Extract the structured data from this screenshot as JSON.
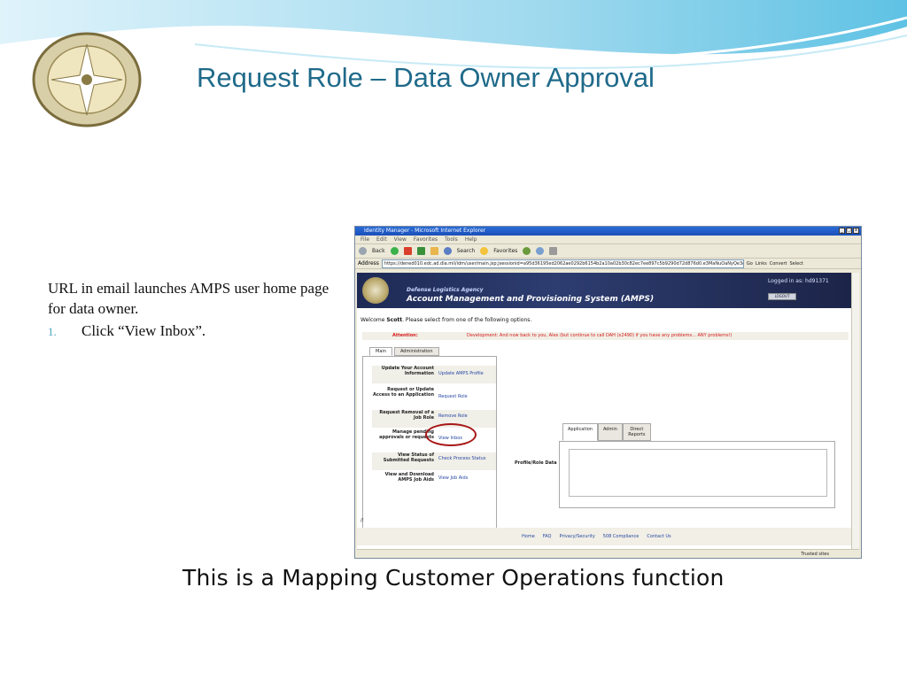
{
  "slide": {
    "title": "Request Role – Data Owner Approval",
    "notes": {
      "intro": "URL in email launches AMPS user home page for data owner.",
      "step_number": "1.",
      "step_text": "Click “View Inbox”."
    },
    "caption": "This is a Mapping Customer Operations function"
  },
  "browser": {
    "window_title": "Identity Manager - Microsoft Internet Explorer",
    "menu": [
      "File",
      "Edit",
      "View",
      "Favorites",
      "Tools",
      "Help"
    ],
    "toolbar": {
      "back": "Back",
      "search": "Search",
      "favorites": "Favorites"
    },
    "address_label": "Address",
    "url": "https://dened010.edc.ad.dla.mil/idm/user/main.jsp;jsessionid=a95d36195ed2062ae0292b6154b2a10a02b30c82ec7ee897c5b9290d72d876d0.e3MaNuOaNyQe3qSa",
    "go": "Go",
    "links": "Links",
    "convert": "Convert",
    "select": "Select",
    "status_zone": "Trusted sites"
  },
  "amps": {
    "agency": "Defense Logistics Agency",
    "system_name": "Account Management and Provisioning System (AMPS)",
    "logged_in": "Logged in as: hd91371",
    "logout": "LOGOUT",
    "welcome_prefix": "Welcome ",
    "welcome_user": "Scott",
    "welcome_suffix": ". Please select from one of the following options.",
    "attention_label": "Attention:",
    "attention_msg": "Development: And now back to you, Alex (but continue to call DAH (x2490) if you have any problems... ANY problems!)",
    "tabs": [
      "Main",
      "Administration"
    ],
    "options": [
      {
        "label": "Update Your Account Information",
        "link": "Update AMPS Profile"
      },
      {
        "label": "Request or Update Access to an Application",
        "link": "Request Role"
      },
      {
        "label": "Request Removal of a Job Role",
        "link": "Remove Role"
      },
      {
        "label": "Manage pending approvals or requests",
        "link": "View Inbox"
      },
      {
        "label": "View Status of Submitted Requests",
        "link": "Check Process Status"
      },
      {
        "label": "View and Download AMPS Job Aids",
        "link": "View Job Aids"
      }
    ],
    "profile_tabs": [
      "Application",
      "Admin",
      "Direct Reports"
    ],
    "profile_label": "Profile/Role Data",
    "slash": "//",
    "footer_links": [
      "Home",
      "FAQ",
      "Privacy/Security",
      "508 Compliance",
      "Contact Us"
    ]
  },
  "colors": {
    "title": "#1f6a8a",
    "attention": "#d61c1c",
    "link": "#2747a3",
    "highlight_oval": "#a81616"
  }
}
